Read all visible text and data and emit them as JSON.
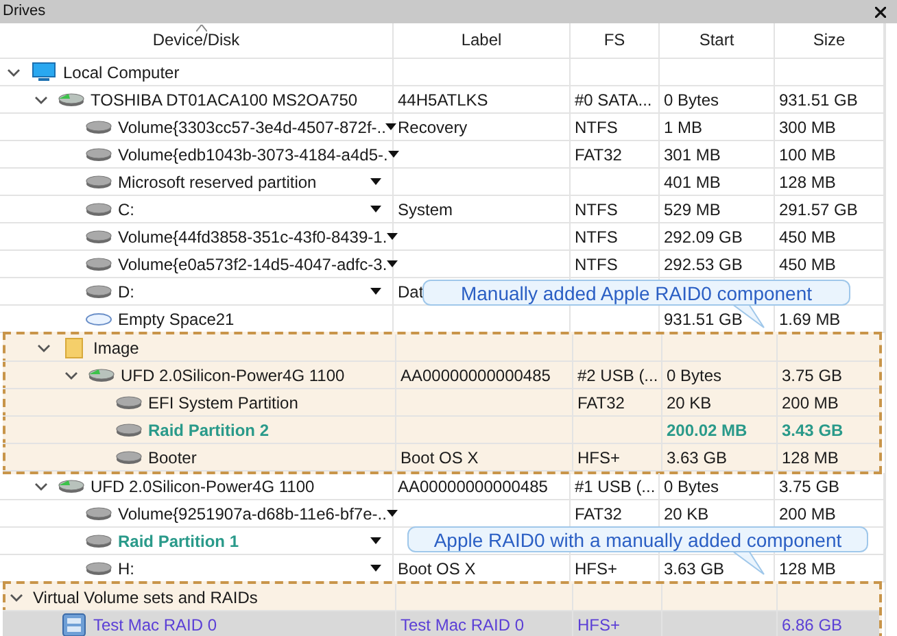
{
  "panel": {
    "title": "Drives"
  },
  "columns": [
    {
      "label": "Device/Disk",
      "sorted": true
    },
    {
      "label": "Label",
      "sorted": false
    },
    {
      "label": "FS",
      "sorted": false
    },
    {
      "label": "Start",
      "sorted": false
    },
    {
      "label": "Size",
      "sorted": false
    }
  ],
  "tree": [
    {
      "kind": "computer",
      "name": "Local Computer",
      "expanded": true,
      "children": [
        {
          "kind": "disk",
          "name": "TOSHIBA DT01ACA100 MS2OA750",
          "label": "44H5ATLKS",
          "fs": "#0 SATA...",
          "start": "0 Bytes",
          "size": "931.51 GB",
          "expanded": true,
          "children": [
            {
              "kind": "volume",
              "name": "Volume{3303cc57-3e4d-4507-872f-..",
              "dropdown": true,
              "label": "Recovery",
              "fs": "NTFS",
              "start": "1 MB",
              "size": "300 MB"
            },
            {
              "kind": "volume",
              "name": "Volume{edb1043b-3073-4184-a4d5-.",
              "dropdown": true,
              "fs": "FAT32",
              "start": "301 MB",
              "size": "100 MB"
            },
            {
              "kind": "volume",
              "name": "Microsoft reserved partition",
              "dropdown": true,
              "start": "401 MB",
              "size": "128 MB"
            },
            {
              "kind": "volume",
              "name": "C:",
              "dropdown": true,
              "label": "System",
              "fs": "NTFS",
              "start": "529 MB",
              "size": "291.57 GB"
            },
            {
              "kind": "volume",
              "name": "Volume{44fd3858-351c-43f0-8439-1.",
              "dropdown": true,
              "fs": "NTFS",
              "start": "292.09 GB",
              "size": "450 MB"
            },
            {
              "kind": "volume",
              "name": "Volume{e0a573f2-14d5-4047-adfc-3.",
              "dropdown": true,
              "fs": "NTFS",
              "start": "292.53 GB",
              "size": "450 MB"
            },
            {
              "kind": "volume",
              "name": "D:",
              "dropdown": true,
              "label": "Dat"
            },
            {
              "kind": "space",
              "name": "Empty Space21",
              "start": "931.51 GB",
              "size": "1.69 MB"
            }
          ]
        },
        {
          "kind": "folder",
          "name": "Image",
          "expanded": true,
          "marked": true,
          "children": [
            {
              "kind": "disk",
              "name": "UFD 2.0Silicon-Power4G 1100",
              "label": "AA00000000000485",
              "fs": "#2 USB (...",
              "start": "0 Bytes",
              "size": "3.75 GB",
              "expanded": true,
              "children": [
                {
                  "kind": "volume",
                  "name": "EFI System Partition",
                  "fs": "FAT32",
                  "start": "20 KB",
                  "size": "200 MB"
                },
                {
                  "kind": "volume",
                  "name": "Raid Partition 2",
                  "highlight": true,
                  "start": "200.02 MB",
                  "size": "3.43 GB"
                },
                {
                  "kind": "volume",
                  "name": "Booter",
                  "label": "Boot OS X",
                  "fs": "HFS+",
                  "start": "3.63 GB",
                  "size": "128 MB"
                }
              ]
            }
          ]
        },
        {
          "kind": "disk",
          "name": "UFD 2.0Silicon-Power4G 1100",
          "label": "AA00000000000485",
          "fs": "#1 USB (...",
          "start": "0 Bytes",
          "size": "3.75 GB",
          "expanded": true,
          "children": [
            {
              "kind": "volume",
              "name": "Volume{9251907a-d68b-11e6-bf7e-..",
              "dropdown": true,
              "fs": "FAT32",
              "start": "20 KB",
              "size": "200 MB"
            },
            {
              "kind": "volume",
              "name": "Raid Partition 1",
              "dropdown": true,
              "highlight": true
            },
            {
              "kind": "volume",
              "name": "H:",
              "dropdown": true,
              "label": "Boot OS X",
              "fs": "HFS+",
              "start": "3.63 GB",
              "size": "128 MB"
            }
          ]
        }
      ]
    },
    {
      "kind": "group",
      "name": "Virtual Volume sets and RAIDs",
      "expanded": true,
      "marked": true,
      "children": [
        {
          "kind": "raid",
          "name": "Test Mac RAID 0",
          "selected": true,
          "label": "Test Mac RAID 0",
          "fs": "HFS+",
          "size": "6.86 GB"
        }
      ]
    }
  ],
  "callouts": [
    {
      "text": "Manually added Apple RAID0 component"
    },
    {
      "text": "Apple RAID0 with a manually added component"
    }
  ]
}
